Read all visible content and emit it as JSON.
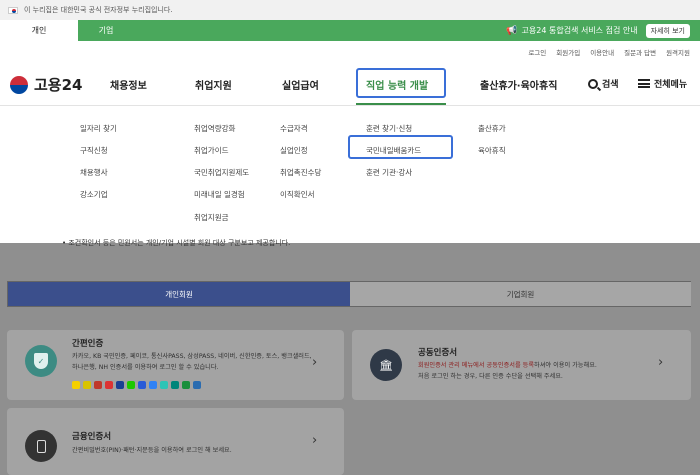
{
  "gov_banner": {
    "text": "이 누리집은 대한민국 공식 전자정부 누리집입니다."
  },
  "persona_tabs": {
    "individual": "개인",
    "business": "기업"
  },
  "notice": {
    "text": "고용24 통합검색 서비스 점검 안내",
    "more": "자세히 보기"
  },
  "util_links": [
    "로그인",
    "회원가입",
    "이용안내",
    "질문과 답변",
    "원격지원"
  ],
  "logo": {
    "text": "고용24"
  },
  "gnb": {
    "items": [
      "채용정보",
      "취업지원",
      "실업급여",
      "직업 능력 개발",
      "출산휴가·육아휴직"
    ],
    "search": "검색",
    "all_menu": "전체메뉴"
  },
  "submenus": {
    "col1": [
      "일자리 찾기",
      "구직신청",
      "채용행사",
      "강소기업"
    ],
    "col2": [
      "취업역량강화",
      "취업가이드",
      "국민취업지원제도",
      "미래내일 일경험",
      "취업지원금"
    ],
    "col3": [
      "수급자격",
      "실업인정",
      "취업촉진수당",
      "이직확인서"
    ],
    "col4": [
      "훈련 찾기·신청",
      "국민내일배움카드",
      "훈련 기관·강사"
    ],
    "col5": [
      "출산휴가",
      "육아휴직"
    ]
  },
  "notice_line": "• 조건확인서 등은 민원서는 개인/기업 시설별 회원 대상 구분보고 제공합니다.",
  "member_tabs": {
    "individual": "개인회원",
    "business": "기업회원"
  },
  "cards": {
    "simple": {
      "title": "간편인증",
      "desc": "카카오, KB 국민인증, 페이코, 통신사PASS, 삼성PASS, 네이버, 신한인증, 토스, 뱅크샐러드, 하나은행, NH 인증서를 이용하여 로그인 할 수 있습니다."
    },
    "joint": {
      "title": "공동인증서",
      "desc_red": "회원인증서 관리 메뉴에서 공동인증서를 등록",
      "desc_rest": "하셔야 이용이 가능해요.",
      "desc2": "처음 로그인 하는 경우, 다른 인증 수단을 선택해 주세요."
    },
    "financial": {
      "title": "금융인증서",
      "desc": "간편비밀번호(PIN)·패턴·지문등을 이용하여 로그인 해 보세요."
    }
  },
  "colors": {
    "green": "#4aa85c",
    "highlight": "#3a6fd8",
    "member_tab": "#3b4f8c"
  }
}
